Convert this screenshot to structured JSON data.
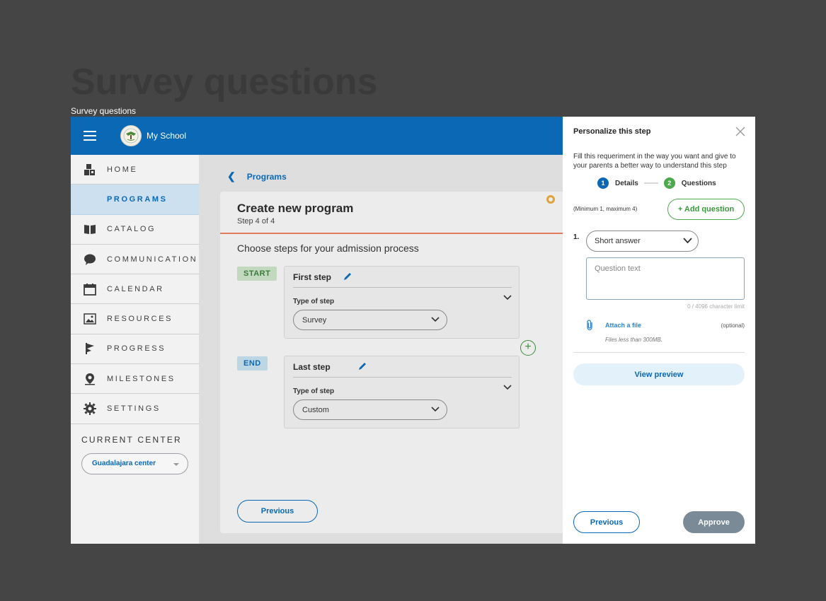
{
  "page": {
    "heading": "Survey questions",
    "subheading": "Survey questions"
  },
  "topbar": {
    "school_name": "My School"
  },
  "sidebar": {
    "items": [
      {
        "label": "HOME",
        "icon": "blocks-icon"
      },
      {
        "label": "PROGRAMS",
        "icon": ""
      },
      {
        "label": "CATALOG",
        "icon": "book-icon"
      },
      {
        "label": "COMMUNICATION",
        "icon": "chat-bubble-icon"
      },
      {
        "label": "CALENDAR",
        "icon": "calendar-icon"
      },
      {
        "label": "RESOURCES",
        "icon": "image-icon"
      },
      {
        "label": "PROGRESS",
        "icon": "flag-icon"
      },
      {
        "label": "MILESTONES",
        "icon": "location-pin-icon"
      },
      {
        "label": "SETTINGS",
        "icon": "gear-icon"
      }
    ],
    "active_item": "PROGRAMS",
    "current_center_label": "CURRENT CENTER",
    "current_center_value": "Guadalajara center"
  },
  "main": {
    "breadcrumb": "Programs",
    "card_title": "Create new program",
    "card_step": "Step 4 of 4",
    "choose_label": "Choose steps for your admission process",
    "steps": [
      {
        "badge": "START",
        "name": "First step",
        "type_label": "Type of step",
        "type_value": "Survey"
      },
      {
        "badge": "END",
        "name": "Last step",
        "type_label": "Type of step",
        "type_value": "Custom"
      }
    ],
    "add_step_symbol": "+",
    "previous_label": "Previous"
  },
  "panel": {
    "title": "Personalize this step",
    "description": "Fill this requeriment in the way you want and give to your parents a better way to understand this step",
    "stepper": [
      {
        "number": "1",
        "label": "Details"
      },
      {
        "number": "2",
        "label": "Questions"
      }
    ],
    "minmax": "(Minimum 1, maximum 4)",
    "add_question_label": "+ Add question",
    "question_number": "1.",
    "answer_type": "Short answer",
    "question_placeholder": "Question text",
    "char_limit": "0 / 4096 character limit",
    "attach_label": "Attach a file",
    "optional_label": "(optional)",
    "files_note": "Files less than 300MB.",
    "view_preview_label": "View preview",
    "previous_label": "Previous",
    "approve_label": "Approve"
  },
  "colors": {
    "primary": "#0a68b5",
    "green": "#4caa4c",
    "accent_rule": "#e07a58",
    "approve_disabled": "#7a8a96"
  }
}
